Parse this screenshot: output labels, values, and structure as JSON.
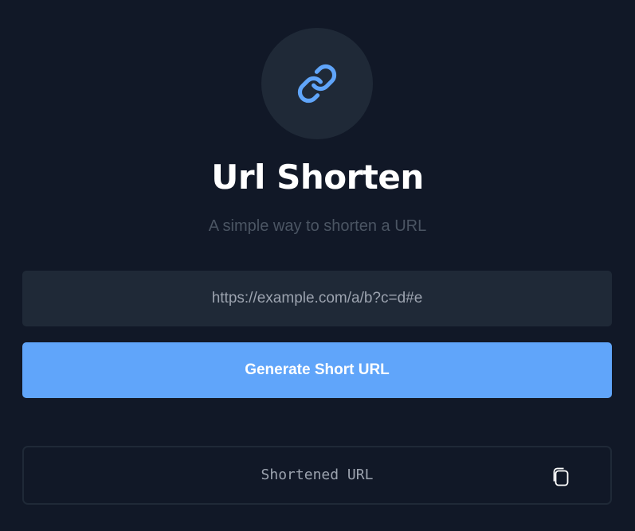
{
  "header": {
    "logo_icon": "link-icon",
    "title": "Url Shorten",
    "subtitle": "A simple way to shorten a URL"
  },
  "form": {
    "url_input_value": "",
    "url_input_placeholder": "https://example.com/a/b?c=d#e",
    "generate_label": "Generate Short URL"
  },
  "result": {
    "text": "Shortened URL",
    "copy_icon": "copy-icon"
  },
  "colors": {
    "background": "#111827",
    "surface": "#1f2937",
    "accent": "#60a5fa",
    "muted_text": "#4b5563"
  }
}
